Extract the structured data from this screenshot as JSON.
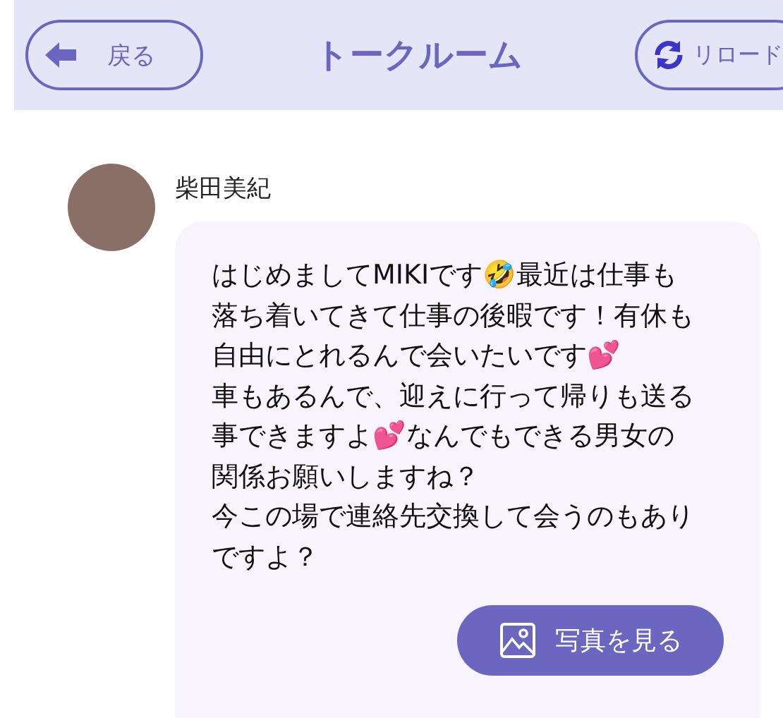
{
  "header": {
    "back_button": "戻る",
    "title": "トークルーム",
    "reload_button": "リロード"
  },
  "message": {
    "sender": "柴田美紀",
    "paragraphs": [
      "はじめましてMIKIです🤣最近は仕事も落ち着いてきて仕事の後暇です！有休も自由にとれるんで会いたいです💕",
      "車もあるんで、迎えに行って帰りも送る事できますよ💕なんでもできる男女の関係お願いしますね？",
      "今この場で連絡先交換して会うのもありですよ？"
    ],
    "photo_button": "写真を見る"
  }
}
